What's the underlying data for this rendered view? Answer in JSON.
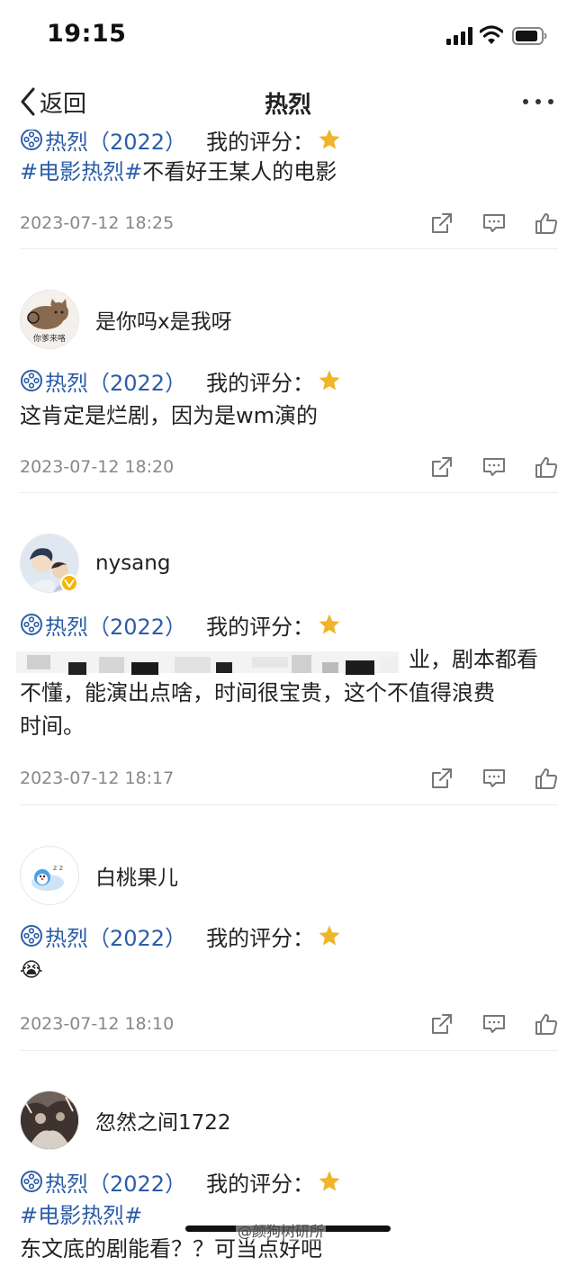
{
  "status_bar": {
    "time": "19:15"
  },
  "nav": {
    "back_label": "返回",
    "title": "热烈"
  },
  "colors": {
    "link_blue": "#2c5da8",
    "star_gold": "#f0b429",
    "meta_gray": "#888888"
  },
  "icons": [
    "chevron-left-icon",
    "more-dots-icon",
    "film-reel-icon",
    "star-icon",
    "share-icon",
    "comment-icon",
    "like-icon"
  ],
  "items": [
    {
      "film": "热烈（2022）",
      "rating_label": "我的评分：",
      "hashtag": "#电影热烈#",
      "text": "不看好王某人的电影",
      "date": "2023-07-12 18:25"
    },
    {
      "username": "是你吗x是我呀",
      "avatar_caption": "你爹来咯",
      "film": "热烈（2022）",
      "rating_label": "我的评分：",
      "text": "这肯定是烂剧，因为是wm演的",
      "date": "2023-07-12 18:20"
    },
    {
      "username": "nysang",
      "film": "热烈（2022）",
      "rating_label": "我的评分：",
      "text_visible_end": "业，剧本都看",
      "text_line2": "不懂，能演出点啥，时间很宝贵，这个不值得浪费",
      "text_line3": "时间。",
      "date": "2023-07-12 18:17"
    },
    {
      "username": "白桃果儿",
      "film": "热烈（2022）",
      "rating_label": "我的评分：",
      "emoji": "😭",
      "date": "2023-07-12 18:10"
    },
    {
      "username": "忽然之间1722",
      "film": "热烈（2022）",
      "rating_label": "我的评分：",
      "hashtag": "#电影热烈#",
      "text_cut": "东文底的剧能看？？可当点好吧"
    }
  ],
  "watermark": "@颜狗树研所"
}
